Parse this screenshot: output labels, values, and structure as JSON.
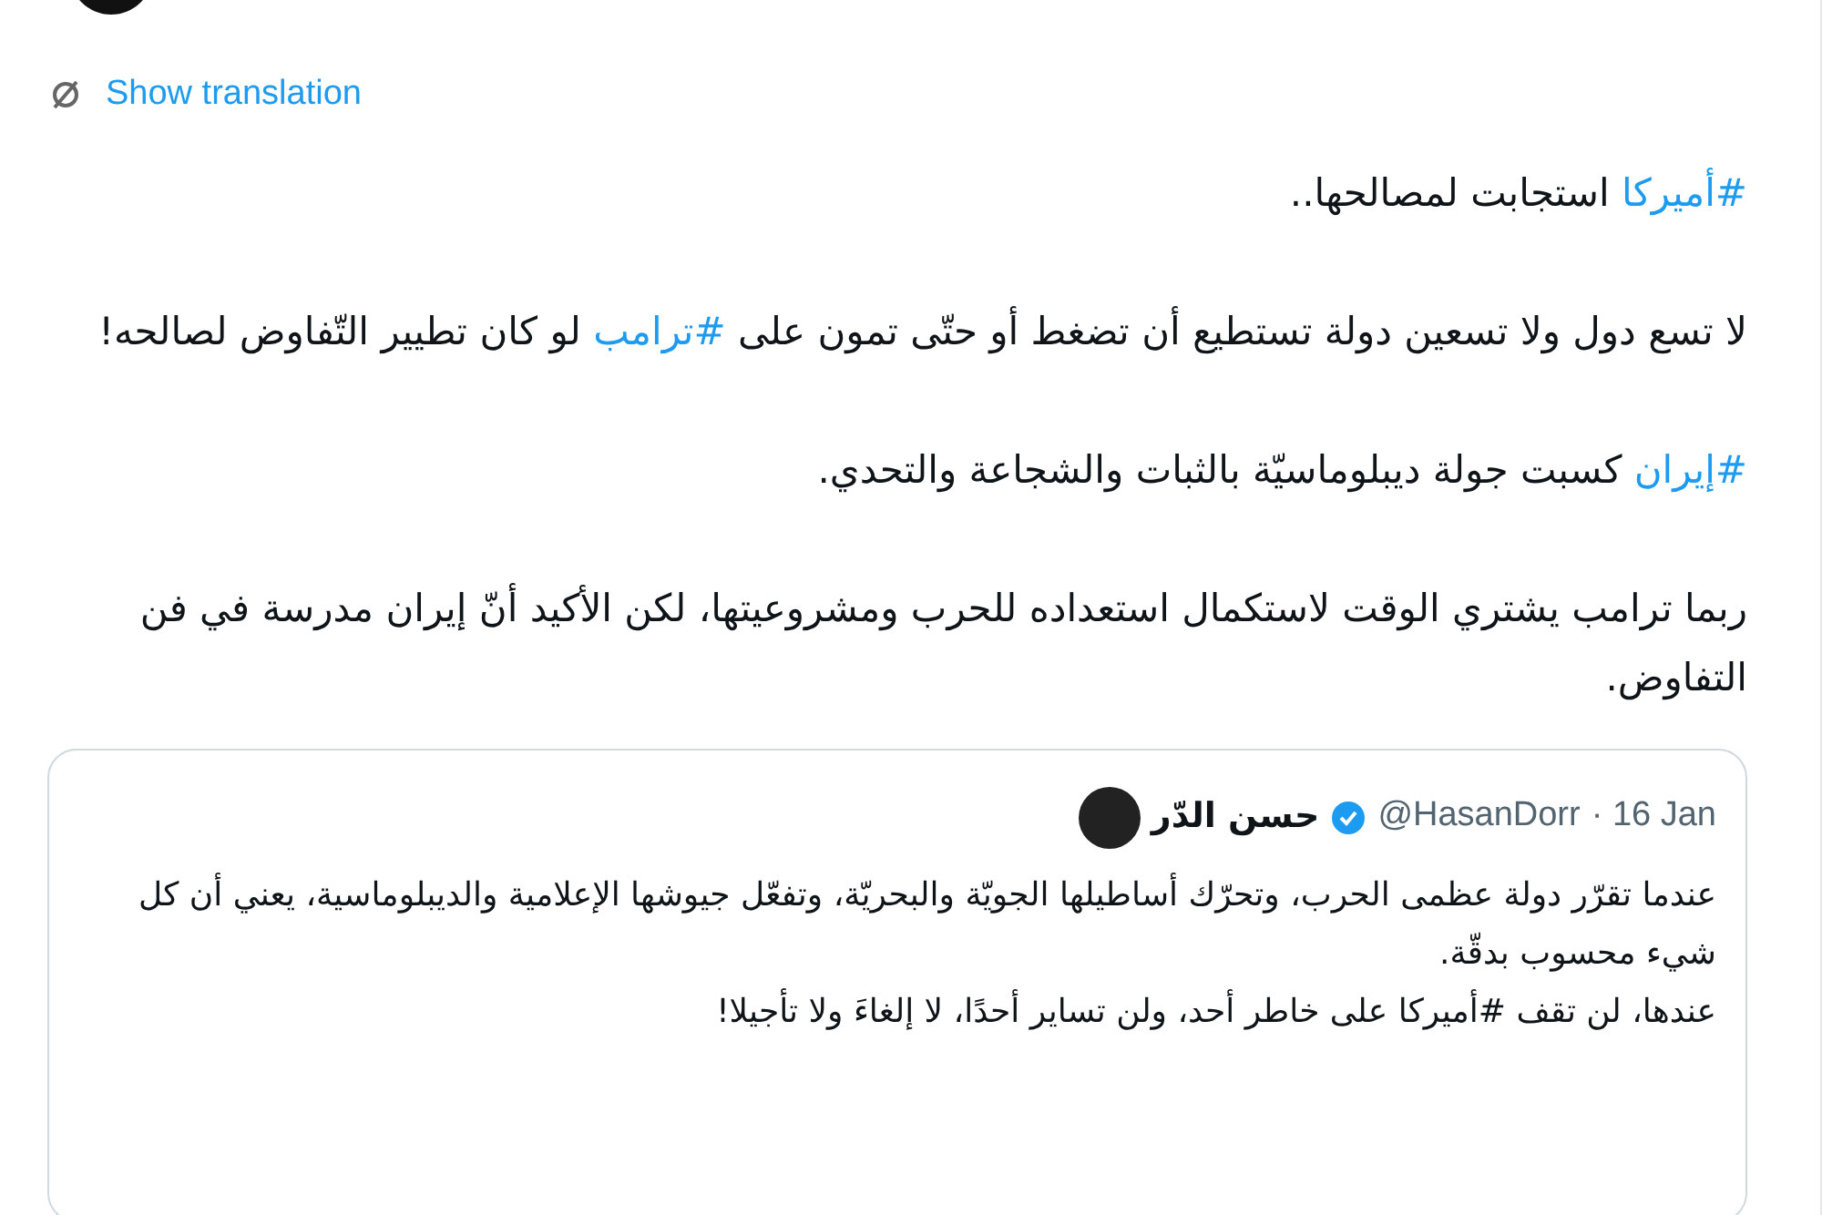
{
  "translate_link": "Show translation",
  "paragraphs": [
    {
      "parts": [
        {
          "kind": "hashtag",
          "text": "#أميركا"
        },
        {
          "kind": "text",
          "text": " استجابت لمصالحها.."
        }
      ]
    },
    {
      "parts": [
        {
          "kind": "text",
          "text": "لا تسع دول ولا تسعين دولة تستطيع أن تضغط أو حتّى تمون على "
        },
        {
          "kind": "hashtag",
          "text": "#ترامب"
        },
        {
          "kind": "text",
          "text": " لو كان تطيير التّفاوض لصالحه!"
        }
      ]
    },
    {
      "parts": [
        {
          "kind": "hashtag",
          "text": "#إيران"
        },
        {
          "kind": "text",
          "text": " كسبت جولة ديبلوماسيّة بالثبات والشجاعة والتحدي."
        }
      ]
    },
    {
      "parts": [
        {
          "kind": "text",
          "text": "ربما ترامب يشتري الوقت لاستكمال استعداده للحرب ومشروعيتها، لكن الأكيد أنّ إيران مدرسة في فن التفاوض."
        }
      ]
    }
  ],
  "quote": {
    "name": "حسن الدّر",
    "verified": true,
    "handle": "@HasanDorr",
    "date": "· 16 Jan",
    "lines": [
      "عندما تقرّر دولة عظمى الحرب، وتحرّك أساطيلها الجويّة والبحريّة، وتفعّل جيوشها الإعلامية والديبلوماسية، يعني أن كل شيء محسوب بدقّة.",
      "عندها، لن تقف #أميركا على خاطر أحد، ولن تساير أحدًا، لا إلغاءَ ولا تأجيلا!"
    ]
  }
}
